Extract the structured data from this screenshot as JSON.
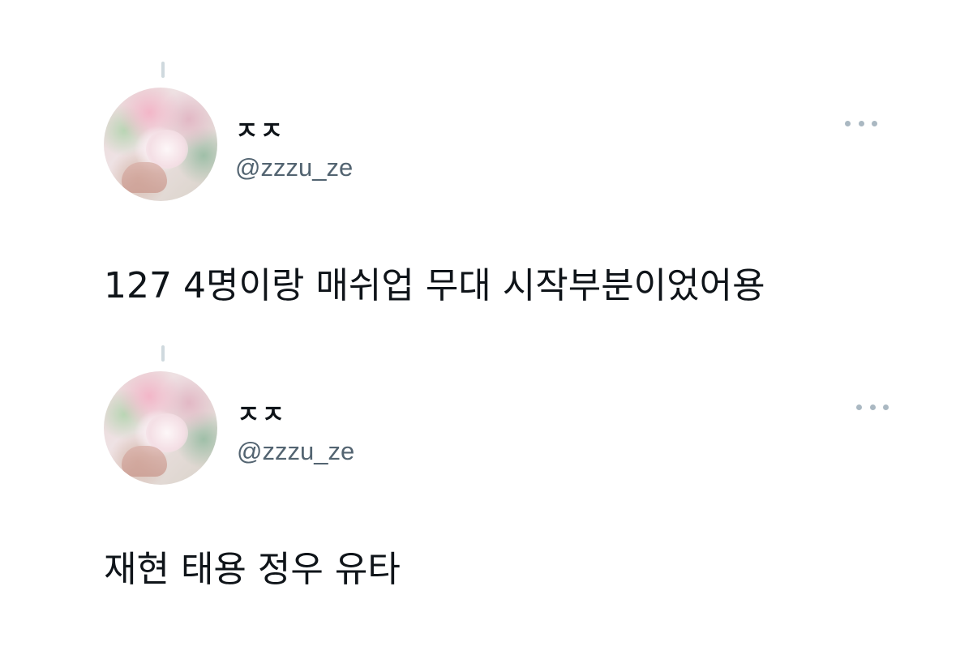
{
  "tweets": [
    {
      "display_name": "ㅈㅈ",
      "handle": "@zzzu_ze",
      "text": "127 4명이랑 매쉬업 무대 시작부분이었어용",
      "more_icon": "more-horizontal-icon",
      "avatar": "profile-avatar"
    },
    {
      "display_name": "ㅈㅈ",
      "handle": "@zzzu_ze",
      "text": "재현 태용 정우 유타",
      "more_icon": "more-horizontal-icon",
      "avatar": "profile-avatar"
    }
  ],
  "colors": {
    "text_primary": "#0f1419",
    "text_secondary": "#536471",
    "thread_line": "#cfd9de",
    "more_icon": "#aab8c2"
  }
}
